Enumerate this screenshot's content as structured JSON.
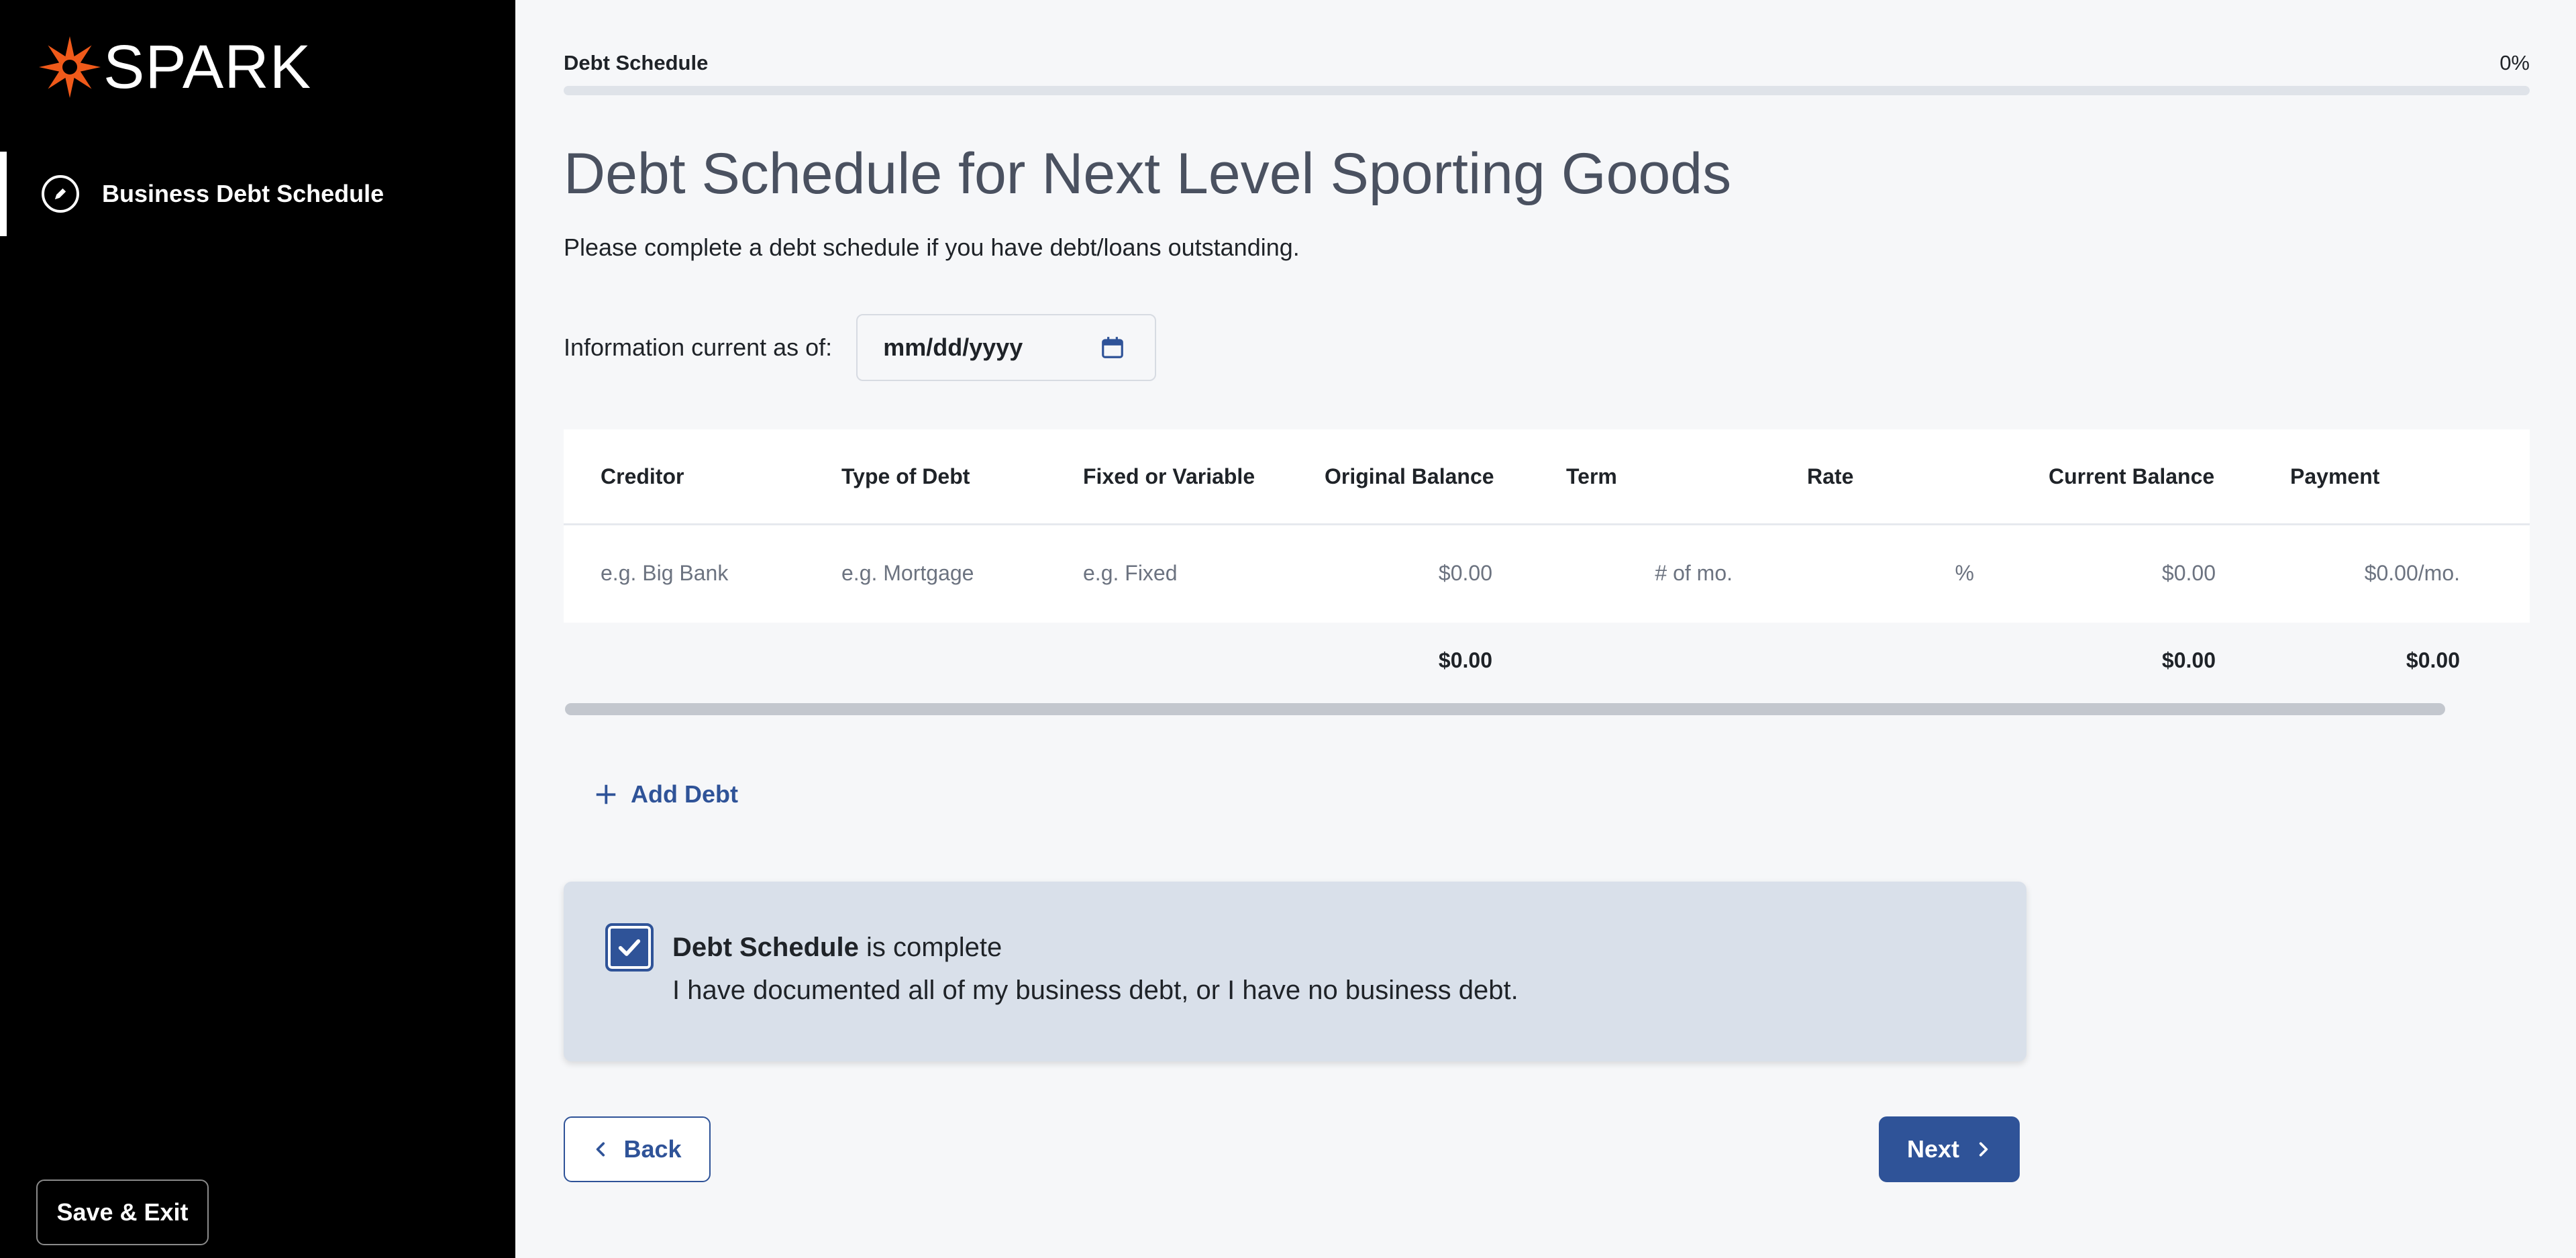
{
  "brand": {
    "name": "SPARK",
    "logo_icon": "spark-starburst-icon",
    "logo_color": "#f05a1a"
  },
  "sidebar": {
    "items": [
      {
        "label": "Business Debt Schedule",
        "icon": "edit-pencil-icon",
        "active": true
      }
    ],
    "save_exit_label": "Save & Exit"
  },
  "progress": {
    "label": "Debt Schedule",
    "value_text": "0%",
    "percent": 0
  },
  "page": {
    "title": "Debt Schedule for Next Level Sporting Goods",
    "subtitle": "Please complete a debt schedule if you have debt/loans outstanding."
  },
  "date_field": {
    "label": "Information current as of:",
    "placeholder": "mm/dd/yyyy",
    "icon": "calendar-icon"
  },
  "table": {
    "columns": [
      "Creditor",
      "Type of Debt",
      "Fixed or Variable",
      "Original Balance",
      "Term",
      "Rate",
      "Current Balance",
      "Payment"
    ],
    "row_placeholders": [
      "e.g. Big Bank",
      "e.g. Mortgage",
      "e.g. Fixed",
      "$0.00",
      "# of mo.",
      "%",
      "$0.00",
      "$0.00/mo."
    ],
    "totals": {
      "original_balance": "$0.00",
      "current_balance": "$0.00",
      "payment": "$0.00"
    }
  },
  "add_debt_label": "Add Debt",
  "completion": {
    "title_bold": "Debt Schedule",
    "title_rest": " is complete",
    "description": "I have documented all of my business debt, or I have no business debt.",
    "checked": true
  },
  "buttons": {
    "back": "Back",
    "next": "Next"
  },
  "colors": {
    "primary": "#2f5398",
    "sidebar_bg": "#000000",
    "page_bg": "#f6f7f9",
    "card_bg": "#d9e0ea"
  }
}
